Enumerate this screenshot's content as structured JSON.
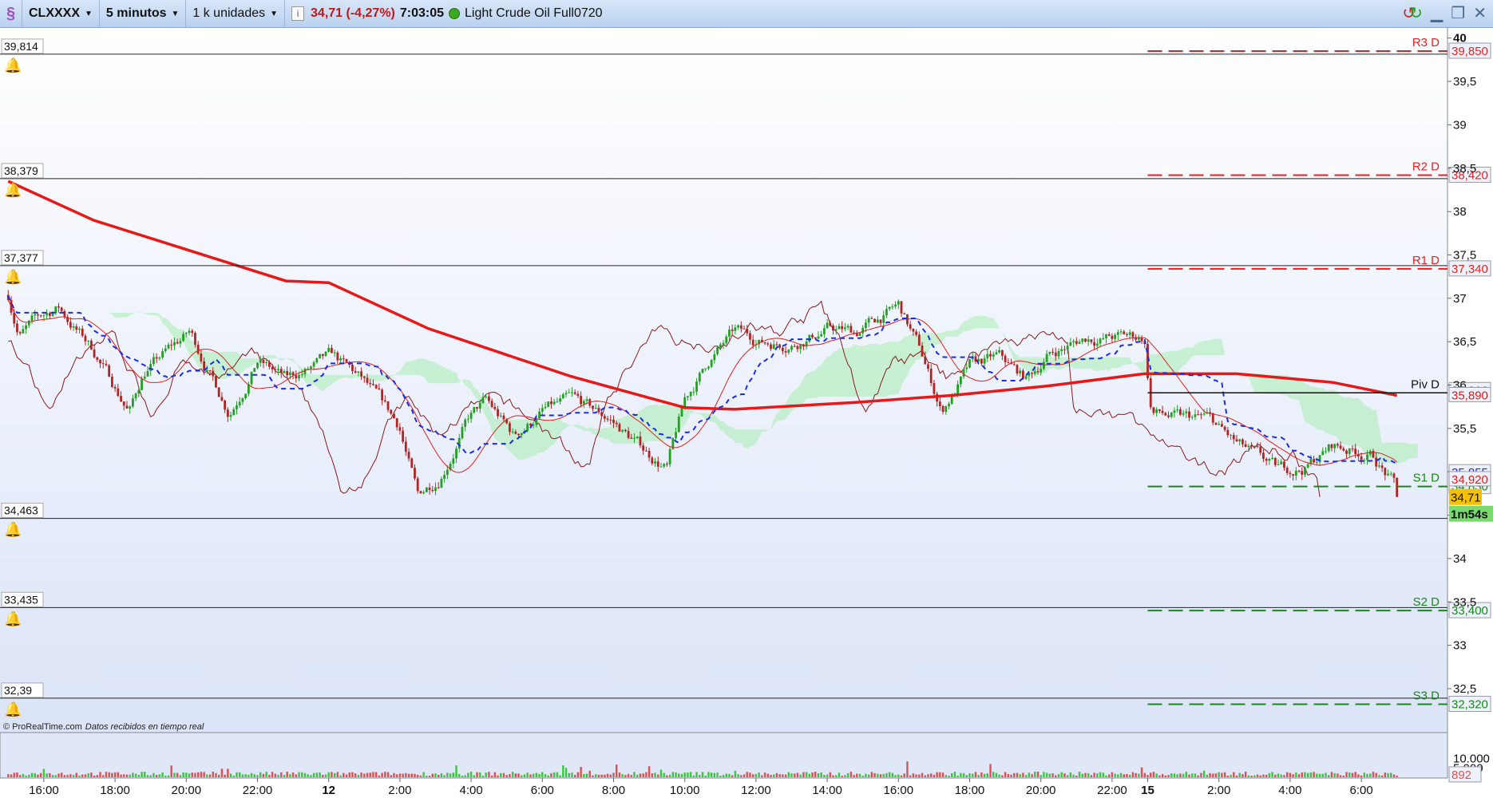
{
  "toolbar": {
    "instrument": "CLXXXX",
    "timeframe": "5 minutos",
    "units": "1 k unidades",
    "last_price": "34,71 (-4,27%)",
    "time": "7:03:05",
    "name": "Light Crude Oil Full0720"
  },
  "window_controls": [
    "refresh-icon",
    "minimize-icon",
    "restore-icon",
    "close-icon"
  ],
  "credit": {
    "site": "© ProRealTime.com",
    "status": "Datos recibidos en tiempo real"
  },
  "colors": {
    "up": "#22a022",
    "down": "#b02424",
    "ma_thick": "#e81818",
    "kijun": "#1a2ce8",
    "cloud": "#a8ecb0",
    "cloud_alt": "#c8f0fa",
    "resistance": "#e82020",
    "support": "#188818"
  },
  "chart_data": {
    "type": "line",
    "style": "candlestick",
    "title": "CLXXXX 5 minutos",
    "ylim": [
      32.2,
      40.0
    ],
    "yticks": [
      "40",
      "39,5",
      "39",
      "38,5",
      "38",
      "37,5",
      "37",
      "36,5",
      "36",
      "35,5",
      "35",
      "34,5",
      "34",
      "33,5",
      "33",
      "32,5"
    ],
    "ytick_values": [
      40,
      39.5,
      39,
      38.5,
      38,
      37.5,
      37,
      36.5,
      36,
      35.5,
      35,
      34.5,
      34,
      33.5,
      33,
      32.5
    ],
    "xticks": [
      {
        "t": 1,
        "label": "16:00"
      },
      {
        "t": 3,
        "label": "18:00"
      },
      {
        "t": 5,
        "label": "20:00"
      },
      {
        "t": 7,
        "label": "22:00"
      },
      {
        "t": 9,
        "label": "12",
        "bold": true
      },
      {
        "t": 11,
        "label": "2:00"
      },
      {
        "t": 13,
        "label": "4:00"
      },
      {
        "t": 15,
        "label": "6:00"
      },
      {
        "t": 17,
        "label": "8:00"
      },
      {
        "t": 19,
        "label": "10:00"
      },
      {
        "t": 21,
        "label": "12:00"
      },
      {
        "t": 23,
        "label": "14:00"
      },
      {
        "t": 25,
        "label": "16:00"
      },
      {
        "t": 27,
        "label": "18:00"
      },
      {
        "t": 29,
        "label": "20:00"
      },
      {
        "t": 31,
        "label": "22:00"
      },
      {
        "t": 32,
        "label": "15",
        "bold": true
      },
      {
        "t": 34,
        "label": "2:00"
      },
      {
        "t": 36,
        "label": "4:00"
      },
      {
        "t": 38,
        "label": "6:00"
      }
    ],
    "price_path": [
      [
        0,
        37.04
      ],
      [
        0.3,
        36.6
      ],
      [
        1.4,
        36.9
      ],
      [
        2.4,
        36.4
      ],
      [
        3.4,
        35.7
      ],
      [
        3.8,
        36.15
      ],
      [
        5.1,
        36.6
      ],
      [
        6.2,
        35.7
      ],
      [
        7.0,
        36.3
      ],
      [
        7.8,
        36.05
      ],
      [
        9.1,
        36.3
      ],
      [
        9.9,
        36.05
      ],
      [
        11.0,
        35.5
      ],
      [
        11.5,
        34.7
      ],
      [
        12.1,
        34.95
      ],
      [
        12.9,
        35.6
      ],
      [
        13.4,
        35.8
      ],
      [
        14.2,
        35.4
      ],
      [
        15.0,
        35.7
      ],
      [
        15.8,
        35.8
      ],
      [
        16.9,
        35.6
      ],
      [
        18.0,
        35.2
      ],
      [
        18.5,
        35.05
      ],
      [
        19.0,
        35.8
      ],
      [
        19.7,
        36.3
      ],
      [
        20.4,
        36.6
      ],
      [
        21.2,
        36.5
      ],
      [
        22.0,
        36.5
      ],
      [
        23.0,
        36.65
      ],
      [
        23.8,
        36.6
      ],
      [
        25.0,
        36.9
      ],
      [
        25.6,
        36.4
      ],
      [
        26.2,
        35.7
      ],
      [
        27.0,
        36.2
      ],
      [
        27.8,
        36.3
      ],
      [
        28.6,
        36.05
      ],
      [
        29.2,
        36.35
      ],
      [
        30.3,
        36.55
      ],
      [
        31.9,
        36.55
      ],
      [
        32.1,
        35.7
      ],
      [
        32.9,
        35.6
      ],
      [
        33.7,
        35.6
      ],
      [
        34.5,
        35.3
      ],
      [
        35.6,
        35.0
      ],
      [
        36.4,
        35.05
      ],
      [
        37.2,
        35.3
      ],
      [
        38.3,
        35.2
      ],
      [
        39.0,
        34.8
      ]
    ],
    "ma_long": [
      [
        0,
        38.35
      ],
      [
        2.4,
        37.9
      ],
      [
        7.8,
        37.2
      ],
      [
        9.0,
        37.18
      ],
      [
        11.8,
        36.65
      ],
      [
        15.8,
        36.1
      ],
      [
        19.0,
        35.74
      ],
      [
        20.4,
        35.72
      ],
      [
        23.8,
        35.8
      ],
      [
        26.5,
        35.88
      ],
      [
        29.2,
        35.99
      ],
      [
        31.9,
        36.13
      ],
      [
        34.5,
        36.13
      ],
      [
        37.2,
        36.03
      ],
      [
        39.0,
        35.88
      ]
    ],
    "alert_lines": [
      {
        "label": "39,814",
        "value": 39.814
      },
      {
        "label": "38,379",
        "value": 38.379
      },
      {
        "label": "37,377",
        "value": 37.377
      },
      {
        "label": "34,463",
        "value": 34.463
      },
      {
        "label": "33,435",
        "value": 33.435
      },
      {
        "label": "32,39",
        "value": 32.39
      }
    ],
    "pivots": [
      {
        "name": "R3 D",
        "value": 39.85,
        "label": "39,850",
        "kind": "resistance"
      },
      {
        "name": "R2 D",
        "value": 38.42,
        "label": "38,420",
        "kind": "resistance"
      },
      {
        "name": "R1 D",
        "value": 37.34,
        "label": "37,340",
        "kind": "resistance"
      },
      {
        "name": "Piv D",
        "value": 35.91,
        "label": "35,910",
        "kind": "pivot"
      },
      {
        "name": "S1 D",
        "value": 34.83,
        "label": "34,830",
        "kind": "support"
      },
      {
        "name": "S2 D",
        "value": 33.4,
        "label": "33,400",
        "kind": "support"
      },
      {
        "name": "S3 D",
        "value": 32.32,
        "label": "32,320",
        "kind": "support"
      }
    ],
    "pivot_start_t": 32,
    "value_tags": [
      {
        "label": "35,890",
        "value": 35.89,
        "color": "#e81818"
      },
      {
        "label": "35,855",
        "value": 35.0,
        "color": "#1a2ce8"
      },
      {
        "label": "34,920",
        "value": 34.92,
        "color": "#e81818"
      }
    ],
    "last": {
      "label": "34,71",
      "value": 34.71
    },
    "countdown": "1m54s",
    "volume": {
      "yticks": [
        "10.000",
        "5.000"
      ],
      "ytick_values": [
        10000,
        5000
      ],
      "last_label": "892",
      "last_value": 892
    }
  }
}
